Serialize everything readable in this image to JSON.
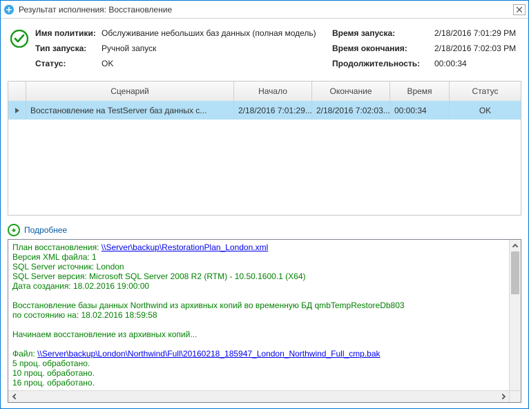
{
  "window": {
    "title": "Результат исполнения: Восстановление"
  },
  "summary": {
    "policy_label": "Имя политики:",
    "policy_value": "Обслуживание небольших баз данных (полная модель)",
    "launch_label": "Тип запуска:",
    "launch_value": "Ручной запуск",
    "status_label": "Статус:",
    "status_value": "OK",
    "start_label": "Время запуска:",
    "start_value": "2/18/2016 7:01:29 PM",
    "end_label": "Время окончания:",
    "end_value": "2/18/2016 7:02:03 PM",
    "dur_label": "Продолжительность:",
    "dur_value": "00:00:34"
  },
  "grid": {
    "columns": {
      "scenario": "Сценарий",
      "start": "Начало",
      "end": "Окончание",
      "time": "Время",
      "status": "Статус"
    },
    "rows": [
      {
        "scenario": "Восстановление на TestServer баз данных с...",
        "start": "2/18/2016 7:01:29...",
        "end": "2/18/2016 7:02:03...",
        "time": "00:00:34",
        "status": "OK"
      }
    ]
  },
  "details": {
    "header": "Подробнее",
    "plan_prefix": "План восстановления: ",
    "plan_link": "\\\\Server\\backup\\RestorationPlan_London.xml",
    "xml_ver": "Версия XML файла: 1",
    "src": "SQL Server источник: London",
    "ver": "SQL Server версия: Microsoft SQL Server 2008 R2 (RTM) - 10.50.1600.1 (X64)",
    "created": "Дата создания: 18.02.2016 19:00:00",
    "restore1": "Восстановление базы данных Northwind из архивных копий во временную БД  qmbTempRestoreDb803",
    "restore2": "по состоянию на: 18.02.2016 18:59:58",
    "begin": "Начинаем восстановление из архивных копий...",
    "file_prefix": "Файл: ",
    "file_link": "\\\\Server\\backup\\London\\Northwind\\Full\\20160218_185947_London_Northwind_Full_cmp.bak",
    "p5": "5 проц. обработано.",
    "p10": "10 проц. обработано.",
    "p16": "16 проц. обработано."
  }
}
